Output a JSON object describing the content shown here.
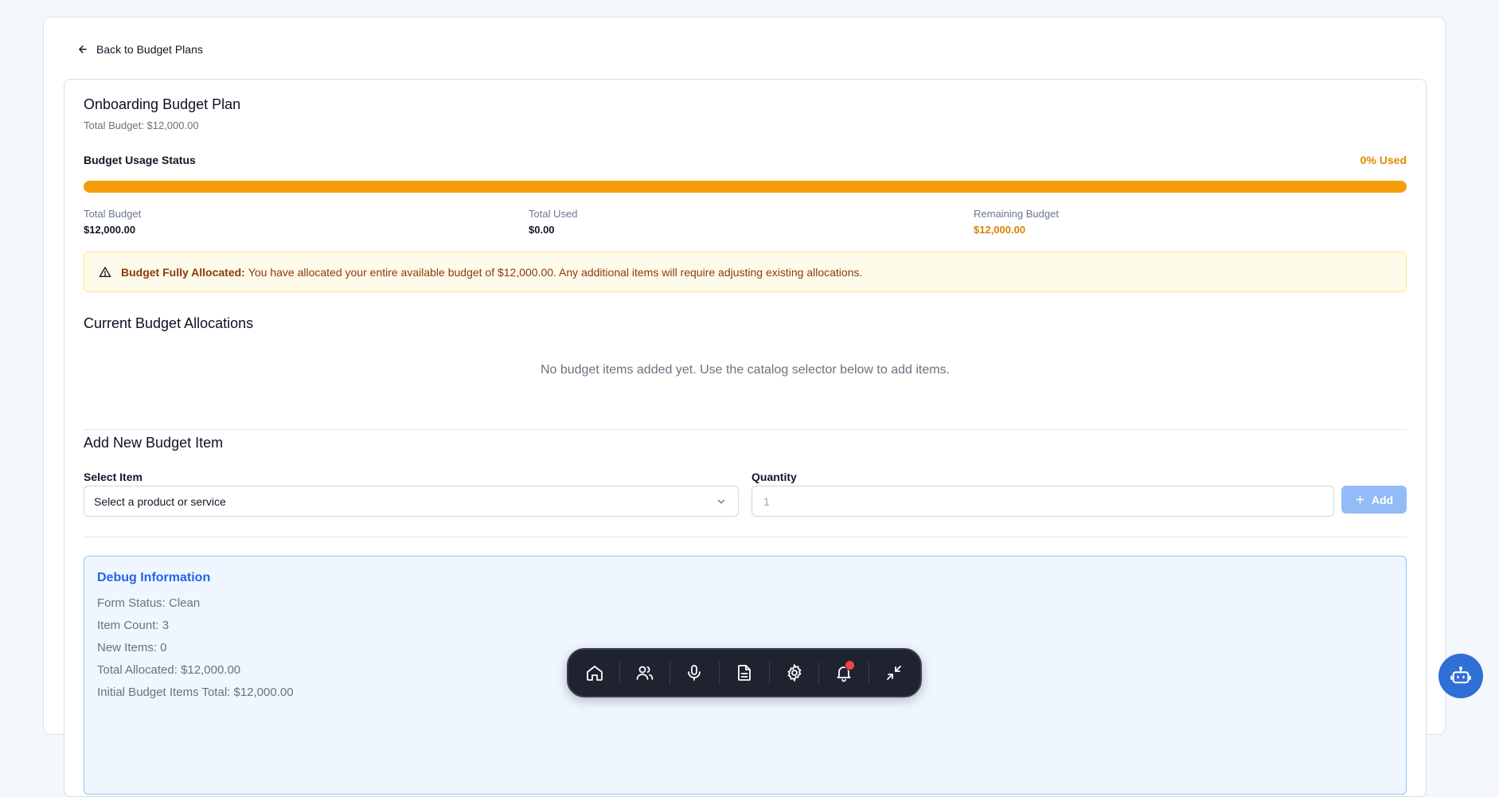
{
  "nav": {
    "back_label": "Back to Budget Plans"
  },
  "plan": {
    "title": "Onboarding Budget Plan",
    "subtitle": "Total Budget: $12,000.00",
    "usage_label": "Budget Usage Status",
    "usage_percent_label": "0% Used",
    "usage_fraction": 0
  },
  "stats": {
    "total_budget": {
      "label": "Total Budget",
      "value": "$12,000.00"
    },
    "total_used": {
      "label": "Total Used",
      "value": "$0.00"
    },
    "remaining": {
      "label": "Remaining Budget",
      "value": "$12,000.00"
    }
  },
  "alert": {
    "title": "Budget Fully Allocated:",
    "message": "You have allocated your entire available budget of $12,000.00. Any additional items will require adjusting existing allocations.",
    "icon": "warning-triangle-icon"
  },
  "allocations": {
    "title": "Current Budget Allocations",
    "empty_message": "No budget items added yet. Use the catalog selector below to add items."
  },
  "add_item": {
    "title": "Add New Budget Item",
    "select_label": "Select Item",
    "select_placeholder": "Select a product or service",
    "quantity_label": "Quantity",
    "quantity_placeholder": "1",
    "add_button": "Add"
  },
  "debug": {
    "title": "Debug Information",
    "lines": [
      "Form Status: Clean",
      "Item Count: 3",
      "New Items: 0",
      "Total Allocated: $12,000.00",
      "Initial Budget Items Total: $12,000.00"
    ]
  },
  "dock": {
    "items": [
      "home-icon",
      "users-icon",
      "microphone-icon",
      "document-icon",
      "settings-icon",
      "bell-icon",
      "minimize-icon"
    ],
    "notification_active": true
  },
  "assistant": {
    "icon": "robot-icon"
  },
  "colors": {
    "accent_orange": "#f59e0b",
    "warning_text": "#8a3a0a",
    "debug_blue": "#2563eb",
    "add_button": "#93bbf7"
  }
}
